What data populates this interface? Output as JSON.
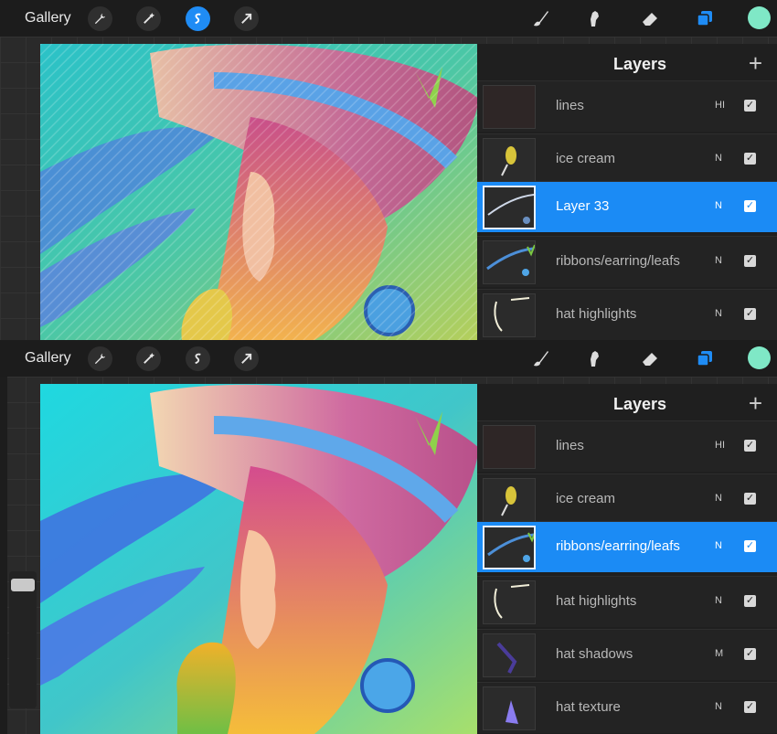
{
  "toolbar": {
    "gallery_label": "Gallery",
    "left_tools": [
      "wrench-icon",
      "magic-wand-icon",
      "selection-icon",
      "move-arrow-icon"
    ],
    "right_tools": [
      "brush-icon",
      "smudge-icon",
      "eraser-icon",
      "layers-icon"
    ],
    "active_color": "#7fe8c6",
    "accent": "#1f8cf5"
  },
  "screen1": {
    "panel_title": "Layers",
    "layers": [
      {
        "name": "lines",
        "mode": "HI",
        "visible": true
      },
      {
        "name": "ice cream",
        "mode": "N",
        "visible": true
      },
      {
        "name": "Layer 33",
        "mode": "N",
        "visible": true,
        "selected": true
      },
      {
        "name": "ribbons/earring/leafs",
        "mode": "N",
        "visible": true
      },
      {
        "name": "hat highlights",
        "mode": "N",
        "visible": true
      }
    ]
  },
  "screen2": {
    "panel_title": "Layers",
    "layers": [
      {
        "name": "lines",
        "mode": "HI",
        "visible": true
      },
      {
        "name": "ice cream",
        "mode": "N",
        "visible": true
      },
      {
        "name": "ribbons/earring/leafs",
        "mode": "N",
        "visible": true,
        "selected": true
      },
      {
        "name": "hat highlights",
        "mode": "N",
        "visible": true
      },
      {
        "name": "hat shadows",
        "mode": "M",
        "visible": true
      },
      {
        "name": "hat texture",
        "mode": "N",
        "visible": true
      }
    ]
  }
}
